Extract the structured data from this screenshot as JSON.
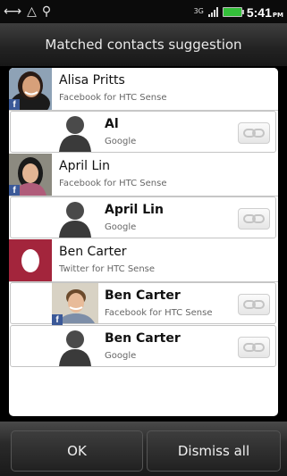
{
  "status_bar": {
    "icons": [
      "usb-connection-icon",
      "warning-triangle-icon",
      "usb-debug-icon"
    ],
    "network_type": "3G",
    "time": "5:41",
    "ampm": "PM",
    "battery_color": "#34c03a"
  },
  "dialog": {
    "title": "Matched contacts suggestion"
  },
  "contacts": [
    {
      "name": "Alisa Pritts",
      "source": "Facebook for HTC Sense",
      "matches": [
        {
          "name": "Al",
          "source": "Google"
        }
      ]
    },
    {
      "name": "April Lin",
      "source": "Facebook for HTC Sense",
      "matches": [
        {
          "name": "April Lin",
          "source": "Google"
        }
      ]
    },
    {
      "name": "Ben Carter",
      "source": "Twitter for HTC Sense",
      "matches": [
        {
          "name": "Ben Carter",
          "source": "Facebook for HTC Sense"
        },
        {
          "name": "Ben Carter",
          "source": "Google"
        }
      ]
    }
  ],
  "buttons": {
    "ok": "OK",
    "dismiss_all": "Dismiss all"
  },
  "colors": {
    "facebook": "#3b5998",
    "twitter_avatar": "#a3253c"
  }
}
